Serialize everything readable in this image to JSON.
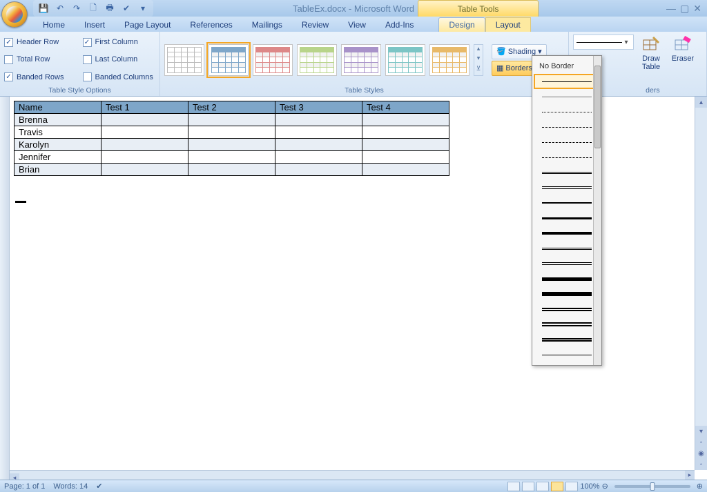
{
  "titlebar": {
    "document": "TableEx.docx",
    "app": "Microsoft Word",
    "context_tab_group": "Table Tools"
  },
  "qat": {
    "save": "save-icon",
    "undo": "undo-icon",
    "redo": "redo-icon",
    "new": "new-icon",
    "print": "print-icon",
    "spell": "spell-icon"
  },
  "tabs": {
    "home": "Home",
    "insert": "Insert",
    "page_layout": "Page Layout",
    "references": "References",
    "mailings": "Mailings",
    "review": "Review",
    "view": "View",
    "addins": "Add-Ins",
    "design": "Design",
    "layout": "Layout",
    "active": "design"
  },
  "table_style_options": {
    "group_label": "Table Style Options",
    "items": [
      {
        "label": "Header Row",
        "checked": true
      },
      {
        "label": "First Column",
        "checked": true
      },
      {
        "label": "Total Row",
        "checked": false
      },
      {
        "label": "Last Column",
        "checked": false
      },
      {
        "label": "Banded Rows",
        "checked": true
      },
      {
        "label": "Banded Columns",
        "checked": false
      }
    ]
  },
  "table_styles": {
    "group_label": "Table Styles",
    "shading_label": "Shading",
    "borders_label": "Borders"
  },
  "draw_borders": {
    "group_label": "Draw Borders",
    "draw_table": "Draw Table",
    "eraser": "Eraser",
    "pen_style_selected": "solid-1"
  },
  "pen_dropdown": {
    "no_border": "No Border",
    "styles": [
      "solid-1",
      "solid-hair",
      "dot",
      "dash",
      "dash-dot",
      "dash-dot-dot",
      "double",
      "triple",
      "thick-1",
      "thick-2",
      "thick-3",
      "thin-thick-1",
      "thin-thick-2",
      "thick-4",
      "thick-5",
      "double-thick-1",
      "double-thick-2",
      "thin-thick-thin",
      "wave"
    ]
  },
  "document": {
    "table": {
      "headers": [
        "Name",
        "Test 1",
        "Test 2",
        "Test 3",
        "Test 4"
      ],
      "rows": [
        [
          "Brenna",
          "",
          "",
          "",
          ""
        ],
        [
          "Travis",
          "",
          "",
          "",
          ""
        ],
        [
          "Karolyn",
          "",
          "",
          "",
          ""
        ],
        [
          "Jennifer",
          "",
          "",
          "",
          ""
        ],
        [
          "Brian",
          "",
          "",
          "",
          ""
        ]
      ]
    }
  },
  "status": {
    "page": "Page: 1 of 1",
    "words": "Words: 14",
    "zoom": "100%"
  }
}
